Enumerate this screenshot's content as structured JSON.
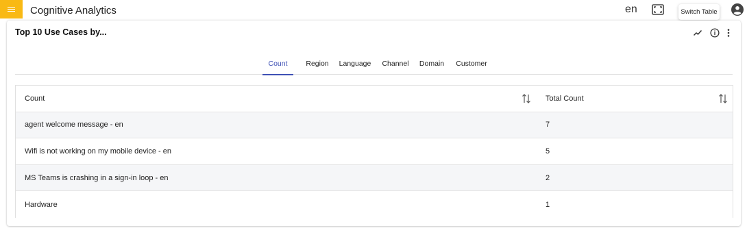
{
  "app": {
    "title": "Cognitive Analytics",
    "language": "en",
    "tooltip": "Switch Table",
    "menu_icon": "menu-icon",
    "fullscreen_icon": "fullscreen-icon",
    "account_icon": "account-circle-icon",
    "accent_color": "#f9b914"
  },
  "card": {
    "title": "Top 10 Use Cases by...",
    "actions": [
      "trend-icon",
      "info-icon",
      "more-vert-icon"
    ]
  },
  "tabs": [
    {
      "label": "Count",
      "active": true
    },
    {
      "label": "Region",
      "active": false
    },
    {
      "label": "Language",
      "active": false
    },
    {
      "label": "Channel",
      "active": false
    },
    {
      "label": "Domain",
      "active": false
    },
    {
      "label": "Customer",
      "active": false
    }
  ],
  "table": {
    "columns": [
      "Count",
      "Total Count"
    ],
    "rows": [
      [
        "agent welcome message - en",
        "7"
      ],
      [
        "Wifi is not working on my mobile device - en",
        "5"
      ],
      [
        "MS Teams is crashing in a sign-in loop - en",
        "2"
      ],
      [
        "Hardware",
        "1"
      ]
    ]
  },
  "colors": {
    "tab_active": "#3f51b5",
    "row_shaded": "#f5f6f8"
  }
}
